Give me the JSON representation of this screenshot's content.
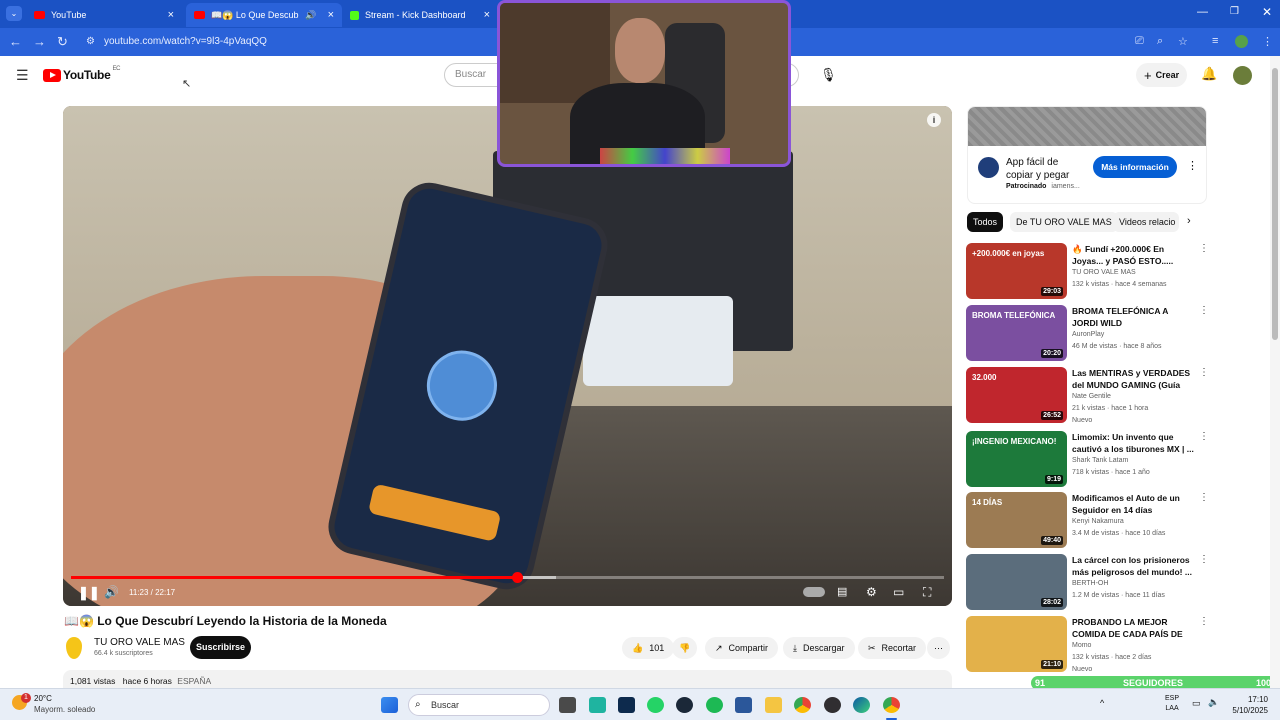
{
  "browser": {
    "tabs": [
      {
        "label": "YouTube"
      },
      {
        "label": "📖😱 Lo Que Descubrí Le"
      },
      {
        "label": "Stream - Kick Dashboard"
      }
    ],
    "url": "youtube.com/watch?v=9l3-4pVaqQQ"
  },
  "header": {
    "logo_text": "YouTube",
    "region": "EC",
    "search_placeholder": "Buscar",
    "create_label": "Crear"
  },
  "player": {
    "time": "11:23 / 22:17",
    "progress_fraction": 0.511,
    "buffered_fraction": 0.555
  },
  "video": {
    "title": "📖😱 Lo Que Descubrí Leyendo la Historia de la Moneda",
    "channel": "TU ORO VALE MAS",
    "subscribers": "66.4 k suscriptores",
    "subscribe_label": "Suscribirse",
    "likes": "101",
    "share_label": "Compartir",
    "download_label": "Descargar",
    "clip_label": "Recortar",
    "views": "1,081 vistas",
    "age": "hace 6 horas",
    "country": "ESPAÑA"
  },
  "ad": {
    "title_line1": "App fácil de",
    "title_line2": "copiar y pegar",
    "sponsored": "Patrocinado",
    "advertiser": "iamens...",
    "cta": "Más información"
  },
  "chips": [
    "Todos",
    "De TU ORO VALE MAS",
    "Videos relacio"
  ],
  "recommendations": [
    {
      "title": "🔥 Fundí +200.000€ En Joyas... y PASÓ ESTO.....",
      "channel": "TU ORO VALE MAS",
      "meta": "132 k vistas · hace 4 semanas",
      "duration": "29:03",
      "thumb_color": "#b8372a",
      "overlay": "+200.000€ en joyas"
    },
    {
      "title": "BROMA TELEFÓNICA A JORDI WILD",
      "channel": "AuronPlay",
      "meta": "46 M de vistas · hace 8 años",
      "duration": "20:20",
      "thumb_color": "#7b4fa0",
      "overlay": "BROMA TELEFÓNICA"
    },
    {
      "title": "Las MENTIRAS y VERDADES del MUNDO GAMING (Guía Anti-...",
      "channel": "Nate Gentile",
      "meta": "21 k vistas · hace 1 hora",
      "badge": "Nuevo",
      "duration": "26:52",
      "thumb_color": "#c0262d",
      "overlay": "32.000"
    },
    {
      "title": "Limomix: Un invento que cautivó a los tiburones MX | ...",
      "channel": "Shark Tank Latam",
      "meta": "718 k vistas · hace 1 año",
      "duration": "9:19",
      "thumb_color": "#1d7a3b",
      "overlay": "¡INGENIO MEXICANO!"
    },
    {
      "title": "Modificamos el Auto de un Seguidor en 14 días",
      "channel": "Kenyi Nakamura",
      "meta": "3.4 M de vistas · hace 10 días",
      "duration": "49:40",
      "thumb_color": "#9c7b53",
      "overlay": "14 DÍAS"
    },
    {
      "title": "La cárcel con los prisioneros más peligrosos del mundo! ...",
      "channel": "BERTH-OH",
      "meta": "1.2 M de vistas · hace 11 días",
      "duration": "28:02",
      "thumb_color": "#5b6d7c",
      "overlay": ""
    },
    {
      "title": "PROBANDO LA MEJOR COMIDA DE CADA PAÍS DE LATAM",
      "channel": "Momo",
      "meta": "132 k vistas · hace 2 días",
      "badge": "Nuevo",
      "duration": "21:10",
      "thumb_color": "#e3b14a",
      "overlay": ""
    }
  ],
  "overlay_followers": {
    "left": "91",
    "label": "SEGUIDORES",
    "right": "100"
  },
  "taskbar": {
    "weather_temp": "20°C",
    "weather_desc": "Mayorm. soleado",
    "weather_badge": "1",
    "search": "Buscar",
    "lang_line1": "ESP",
    "lang_line2": "LAA",
    "time": "17:10",
    "date": "5/10/2025"
  }
}
